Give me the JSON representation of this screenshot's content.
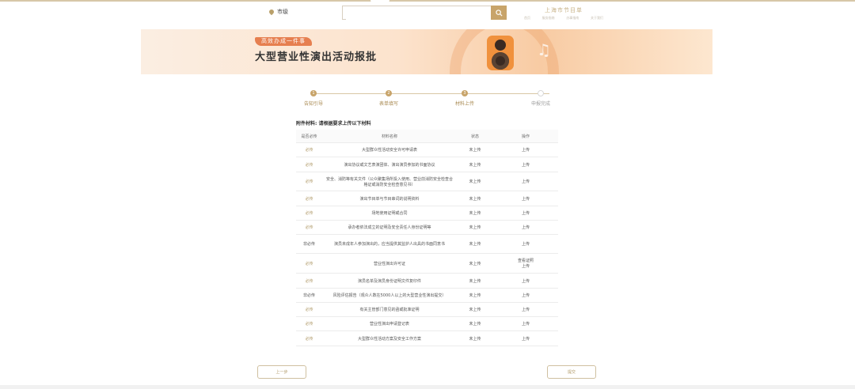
{
  "header": {
    "location_label": "市级",
    "search_placeholder": "",
    "portal_title": "上海市节目单",
    "portal_links": [
      "首页",
      "服务指南",
      "办事指南",
      "关于我们"
    ]
  },
  "banner": {
    "badge": "高效办成一件事",
    "title": "大型营业性演出活动报批"
  },
  "steps": [
    {
      "label": "告知引导",
      "num": "1",
      "state": "done"
    },
    {
      "label": "表单填写",
      "num": "2",
      "state": "done"
    },
    {
      "label": "材料上传",
      "num": "3",
      "state": "active"
    },
    {
      "label": "申报完成",
      "num": "4",
      "state": "todo"
    }
  ],
  "note": "附件材料: 请根据要求上传以下材料",
  "table": {
    "headers": [
      "是否必传",
      "材料名称",
      "状态",
      "操作"
    ],
    "rows": [
      {
        "required": "必传",
        "name": "大型群众性活动安全许可申请表",
        "status": "未上传",
        "action": "上传"
      },
      {
        "required": "必传",
        "name": "演出协议或文艺表演团体、演出演员参加的书面协议",
        "status": "未上传",
        "action": "上传"
      },
      {
        "required": "必传",
        "name": "安全、消防等有关文件（公众聚集场所投入使用、营业前消防安全检查合格证或消防安全检查意见书）",
        "status": "未上传",
        "action": "上传"
      },
      {
        "required": "必传",
        "name": "演出节目单与节目串词的说明资料",
        "status": "未上传",
        "action": "上传"
      },
      {
        "required": "必传",
        "name": "场地使用证明或合同",
        "status": "未上传",
        "action": "上传"
      },
      {
        "required": "必传",
        "name": "承办者依法成立的证明及安全责任人身份证明等",
        "status": "未上传",
        "action": "上传"
      },
      {
        "required": "非必传",
        "name": "演员未成年人参加演出的，应当提供其监护人出具的书面同意书",
        "status": "未上传",
        "action": "上传"
      },
      {
        "required": "必传",
        "name": "营业性演出许可证",
        "status": "未上传",
        "action": "查看证照\n上传"
      },
      {
        "required": "必传",
        "name": "演员名单及演员身份证明文件复印件",
        "status": "未上传",
        "action": "上传"
      },
      {
        "required": "非必传",
        "name": "风险评估报告（观众人数在5000人以上的大型营业性演出提交）",
        "status": "未上传",
        "action": "上传"
      },
      {
        "required": "必传",
        "name": "有关主管部门意见的函或批准证明",
        "status": "未上传",
        "action": "上传"
      },
      {
        "required": "必传",
        "name": "营业性演出申请登记表",
        "status": "未上传",
        "action": "上传"
      },
      {
        "required": "必传",
        "name": "大型群众性活动方案及安全工作方案",
        "status": "未上传",
        "action": "上传"
      }
    ]
  },
  "buttons": {
    "prev": "上一步",
    "submit": "提交"
  }
}
